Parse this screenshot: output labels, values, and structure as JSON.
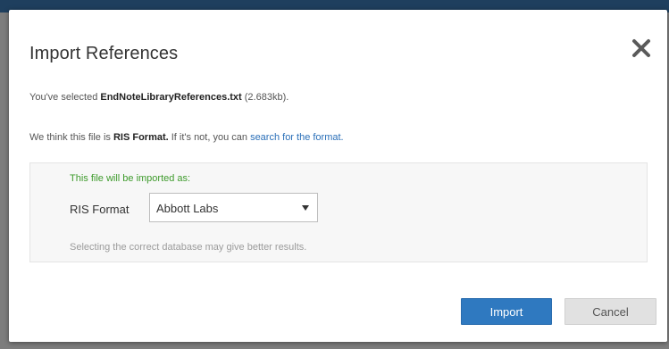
{
  "dialog": {
    "title": "Import References",
    "close_glyph": "✕",
    "selected_prefix": "You've selected ",
    "selected_file": "EndNoteLibraryReferences.txt",
    "selected_size": " (2.683kb).",
    "detect_prefix": "We think this file is ",
    "detect_format": "RIS Format.",
    "detect_middle": " If it's not, you can ",
    "detect_link": "search for the format."
  },
  "panel": {
    "imported_as": "This file will be imported as:",
    "format_label": "RIS Format",
    "selected_option": "Abbott Labs",
    "hint": "Selecting the correct database may give better results."
  },
  "buttons": {
    "import": "Import",
    "cancel": "Cancel"
  },
  "colors": {
    "accent": "#2f79c0",
    "success_text": "#3e9b2c",
    "link": "#2a6fb8",
    "backdrop_bar": "#1f3f5e"
  },
  "icons": {
    "close": "close-icon",
    "dropdown": "chevron-down-icon"
  }
}
